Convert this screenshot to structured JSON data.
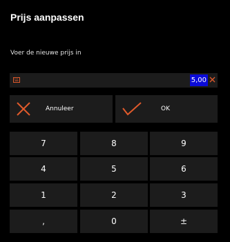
{
  "dialog": {
    "title": "Prijs aanpassen",
    "prompt": "Voer de nieuwe prijs in"
  },
  "price_input": {
    "value": "5,00",
    "keyboard_icon": "keyboard-icon",
    "clear_icon": "close-icon"
  },
  "actions": {
    "cancel_label": "Annuleer",
    "cancel_icon": "close-icon",
    "ok_label": "OK",
    "ok_icon": "checkmark-icon"
  },
  "keypad": {
    "keys": [
      "7",
      "8",
      "9",
      "4",
      "5",
      "6",
      "1",
      "2",
      "3",
      ",",
      "0",
      "±"
    ]
  },
  "colors": {
    "background": "#000000",
    "panel": "#1c1c1c",
    "accent_orange": "#e05a2b",
    "selection_blue": "#0b0bd8"
  }
}
